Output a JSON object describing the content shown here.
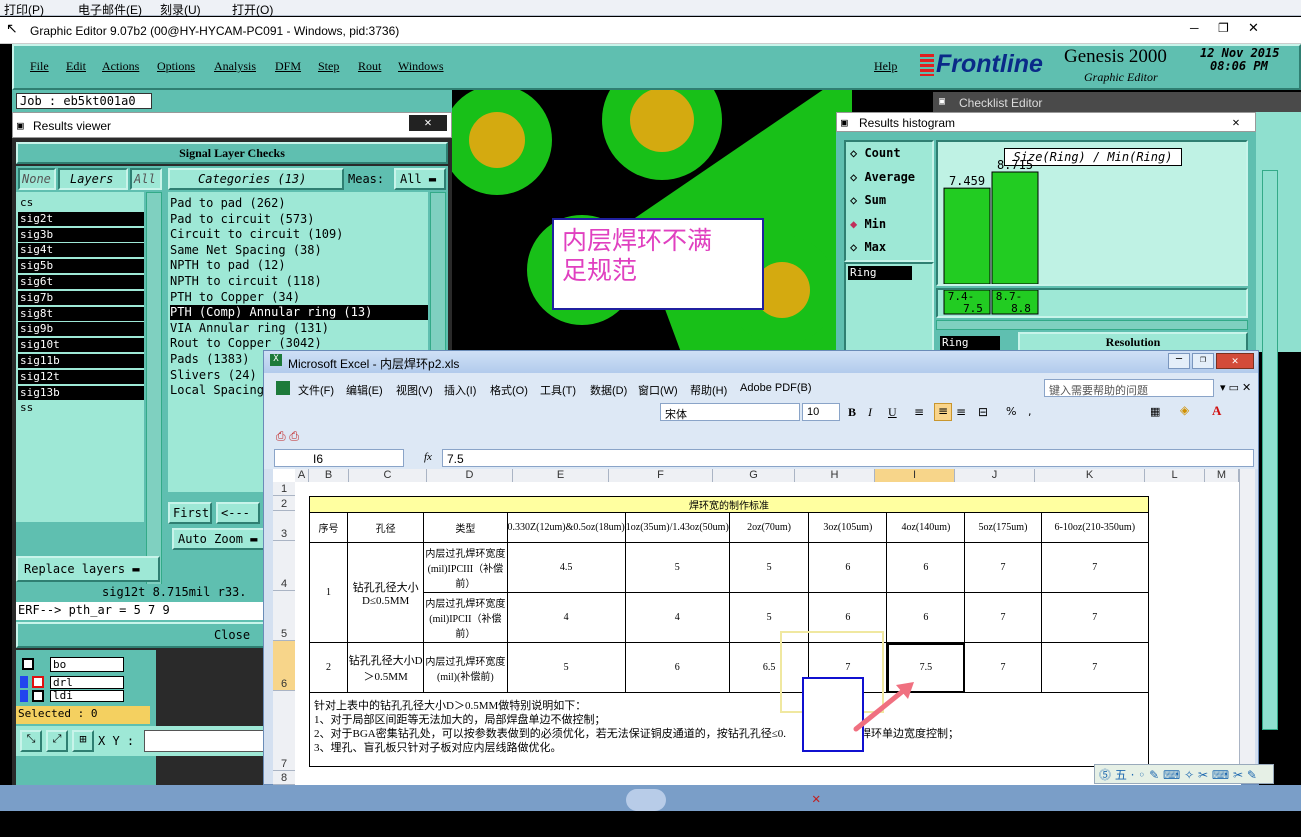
{
  "topbar": {
    "items": [
      "打印(P)",
      "电子邮件(E)",
      "刻录(U)",
      "打开(O)"
    ]
  },
  "genesis": {
    "title": "Graphic Editor 9.07b2 (00@HY-HYCAM-PC091 - Windows, pid:3736)",
    "menu": [
      "File",
      "Edit",
      "Actions",
      "Options",
      "Analysis",
      "DFM",
      "Step",
      "Rout",
      "Windows"
    ],
    "help": "Help",
    "brand": "Frontline",
    "product": "Genesis 2000",
    "product_sub": "Graphic Editor",
    "date": "12 Nov 2015",
    "time": "08:06 PM",
    "job": "Job : eb5kt001a0"
  },
  "results_viewer": {
    "title": "Results viewer",
    "section": "Signal Layer Checks",
    "btn_none": "None",
    "btn_layers": "Layers",
    "btn_all": "All",
    "categories_btn": "Categories (13)",
    "meas_label": "Meas:",
    "meas_value": "All",
    "layers": [
      "cs",
      "sig2t",
      "sig3b",
      "sig4t",
      "sig5b",
      "sig6t",
      "sig7b",
      "sig8t",
      "sig9b",
      "sig10t",
      "sig11b",
      "sig12t",
      "sig13b",
      "ss"
    ],
    "categories": [
      "Pad to pad (262)",
      "Pad to circuit (573)",
      "Circuit to circuit (109)",
      "Same Net Spacing (38)",
      "NPTH to pad (12)",
      "NPTH to circuit (118)",
      "PTH to Copper (34)",
      "PTH (Comp) Annular ring (13)",
      "VIA Annular ring (131)",
      "Rout to Copper (3042)",
      "Pads (1383)",
      "Slivers (24)",
      "Local Spacing"
    ],
    "first": "First",
    "prev": "<---",
    "auto_zoom": "Auto Zoom",
    "replace_layers": "Replace layers",
    "status": "sig12t 8.715mil  r33.",
    "erf": "ERF--> pth_ar = 5 7 9",
    "close": "Close",
    "layer_bo": "bo",
    "layer_drl": "drl",
    "layer_ldi": "ldi",
    "selected": "Selected : 0",
    "xy_label": "X Y :"
  },
  "annotation": {
    "text_line1": "内层焊环不满",
    "text_line2": "足规范"
  },
  "checklist": {
    "title": "Checklist Editor"
  },
  "histogram": {
    "title": "Results histogram",
    "options": [
      "Count",
      "Average",
      "Sum",
      "Min",
      "Max"
    ],
    "selected": "Min",
    "filter": "Ring",
    "header": "Size(Ring) / Min(Ring)",
    "resolution": "Resolution",
    "ring_label": "Ring",
    "chart_data": {
      "type": "bar",
      "categories": [
        "7.4-7.5",
        "8.7-8.8"
      ],
      "values": [
        7.459,
        8.715
      ],
      "title": "Size(Ring) / Min(Ring)"
    }
  },
  "excel": {
    "title": "Microsoft Excel - 内层焊环p2.xls",
    "menu": [
      "文件(F)",
      "编辑(E)",
      "视图(V)",
      "插入(I)",
      "格式(O)",
      "工具(T)",
      "数据(D)",
      "窗口(W)",
      "帮助(H)",
      "Adobe PDF(B)"
    ],
    "help_placeholder": "键入需要帮助的问题",
    "font": "宋体",
    "size": "10",
    "cell_ref": "I6",
    "fx": "fx",
    "formula": "7.5",
    "columns": [
      "A",
      "B",
      "C",
      "D",
      "E",
      "F",
      "G",
      "H",
      "I",
      "J",
      "K",
      "L",
      "M"
    ],
    "rows": [
      "1",
      "2",
      "3",
      "4",
      "5",
      "6",
      "7",
      "8"
    ],
    "table_title": "焊环宽的制作标准",
    "headers": [
      "序号",
      "孔径",
      "类型",
      "0.330Z(12um)&0.5oz(18um)",
      "1oz(35um)/1.43oz(50um)",
      "2oz(70um)",
      "3oz(105um)",
      "4oz(140um)",
      "5oz(175um)",
      "6-10oz(210-350um)"
    ],
    "r1": {
      "no": "1",
      "hole": "钻孔孔径大小D≤0.5MM",
      "type": "内层过孔焊环宽度(mil)IPCIII（补偿前）",
      "vals": [
        "4.5",
        "5",
        "5",
        "6",
        "6",
        "7",
        "7"
      ]
    },
    "r2": {
      "type": "内层过孔焊环宽度(mil)IPCII（补偿前）",
      "vals": [
        "4",
        "4",
        "5",
        "6",
        "6",
        "7",
        "7"
      ]
    },
    "r3": {
      "no": "2",
      "hole": "钻孔孔径大小D＞0.5MM",
      "type": "内层过孔焊环宽度(mil)(补偿前)",
      "vals": [
        "5",
        "6",
        "6.5",
        "7",
        "7.5",
        "7",
        "7"
      ]
    },
    "notes": [
      "针对上表中的钻孔孔径大小D＞0.5MM做特别说明如下：",
      "1、对于局部区间距等无法加大的，局部焊盘单边不做控制；",
      "2、对于BGA密集钻孔处，可以按参数表做到的必须优化，若无法保证铜皮通道的，按钻孔孔径≤0.",
      "焊环单边宽度控制；",
      "3、埋孔、盲孔板只针对子板对应内层线路做优化。"
    ]
  },
  "colors": {
    "teal": "#5fbfb0",
    "green": "#22cc22",
    "annotation": "#e040c0"
  }
}
